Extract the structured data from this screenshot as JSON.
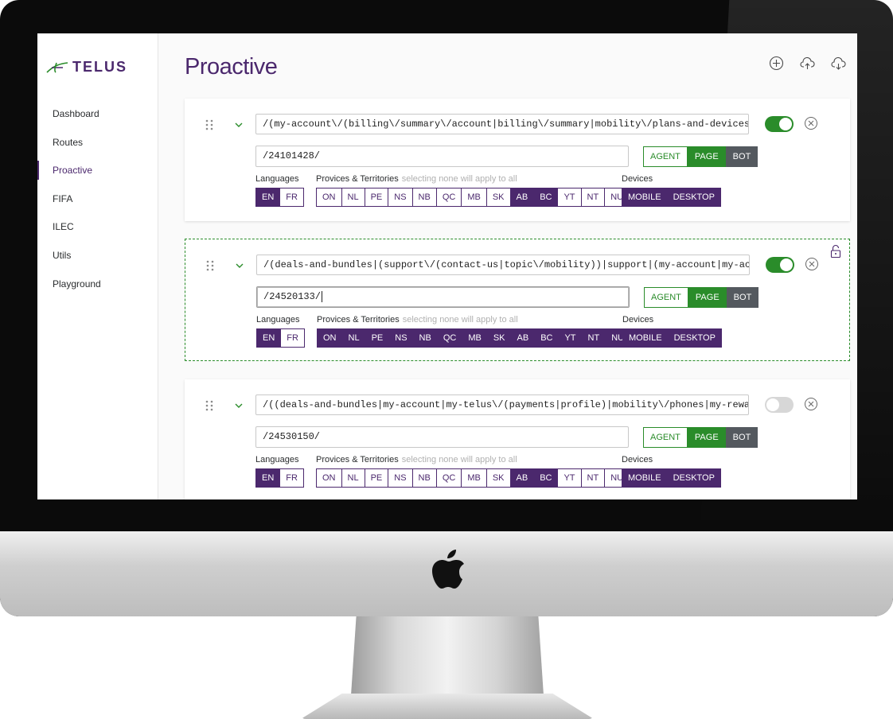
{
  "app": {
    "brand": "TELUS",
    "page_title": "Proactive"
  },
  "colors": {
    "accent": "#4b286d",
    "success": "#2a8c2a",
    "bot": "#54595f"
  },
  "sidebar": {
    "items": [
      {
        "label": "Dashboard",
        "active": false
      },
      {
        "label": "Routes",
        "active": false
      },
      {
        "label": "Proactive",
        "active": true
      },
      {
        "label": "FIFA",
        "active": false
      },
      {
        "label": "ILEC",
        "active": false
      },
      {
        "label": "Utils",
        "active": false
      },
      {
        "label": "Playground",
        "active": false
      }
    ]
  },
  "header_icons": [
    "add-circle-icon",
    "cloud-upload-icon",
    "cloud-download-icon"
  ],
  "labels": {
    "languages": "Languages",
    "provinces": "Provices & Territories",
    "provinces_hint": "selecting none will apply to all",
    "devices": "Devices",
    "agent": "AGENT",
    "page": "PAGE",
    "bot": "BOT",
    "mobile": "MOBILE",
    "desktop": "DESKTOP"
  },
  "languages": [
    "EN",
    "FR"
  ],
  "provinces": [
    "ON",
    "NL",
    "PE",
    "NS",
    "NB",
    "QC",
    "MB",
    "SK",
    "AB",
    "BC",
    "YT",
    "NT",
    "NU"
  ],
  "rules": [
    {
      "pattern": "/(my-account\\/(billing\\/summary\\/account|billing\\/summary|mobility\\/plans-and-devices\\/",
      "page_id": "/24101428/",
      "enabled": true,
      "mode": "PAGE",
      "locked": false,
      "selected": false,
      "languages": [
        "EN"
      ],
      "provinces": [
        "AB",
        "BC"
      ],
      "devices": [
        "MOBILE",
        "DESKTOP"
      ]
    },
    {
      "pattern": "/(deals-and-bundles|(support\\/(contact-us|topic\\/mobility))|support|(my-account|my-account",
      "page_id": "/24520133/",
      "enabled": true,
      "mode": "PAGE",
      "locked": true,
      "selected": true,
      "languages": [
        "EN"
      ],
      "provinces": [
        "ON",
        "NL",
        "PE",
        "NS",
        "NB",
        "QC",
        "MB",
        "SK",
        "AB",
        "BC",
        "YT",
        "NT",
        "NU"
      ],
      "devices": [
        "MOBILE",
        "DESKTOP"
      ]
    },
    {
      "pattern": "/((deals-and-bundles|my-account|my-telus\\/(payments|profile)|mobility\\/phones|my-rewards",
      "page_id": "/24530150/",
      "enabled": false,
      "mode": "PAGE",
      "locked": false,
      "selected": false,
      "languages": [
        "EN"
      ],
      "provinces": [
        "AB",
        "BC"
      ],
      "devices": [
        "MOBILE",
        "DESKTOP"
      ]
    }
  ]
}
